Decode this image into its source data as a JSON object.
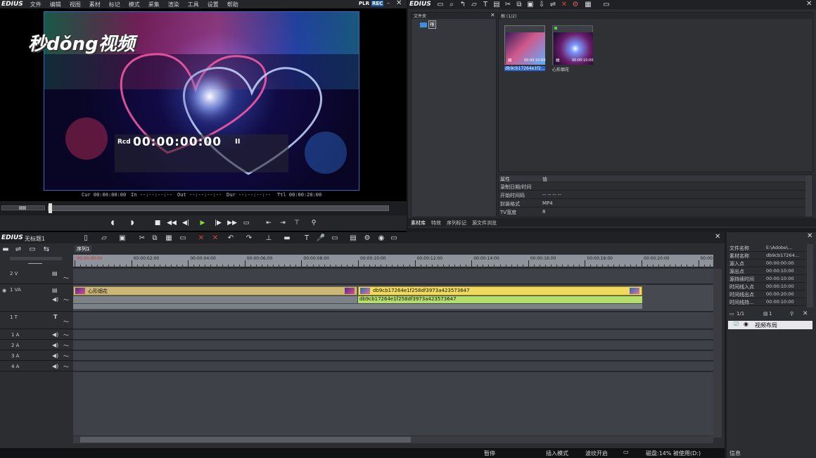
{
  "player": {
    "brand": "EDIUS",
    "menu": [
      "文件",
      "编辑",
      "视图",
      "素材",
      "标记",
      "模式",
      "采集",
      "渲染",
      "工具",
      "设置",
      "帮助"
    ],
    "plr": "PLR",
    "rec": "REC",
    "watermark": "秒dǒng视频",
    "rcd_label": "Rcd",
    "rcd_time": "00:00:00:00",
    "rcd_pause": "II",
    "cur_label": "Cur",
    "cur_time": "00:00:00:00",
    "in_label": "In",
    "in_time": "--:--:--:--",
    "out_label": "Out",
    "out_time": "--:--:--:--",
    "dur_label": "Dur",
    "dur_time": "--:--:--:--",
    "ttl_label": "Ttl",
    "ttl_time": "00:00:20:00"
  },
  "bin": {
    "brand": "EDIUS",
    "folder_panel_title": "文件夹",
    "folder_root": "根",
    "path": "根 (1/2)",
    "clips": [
      {
        "name": "db9cb17264e1f2...",
        "time": "00:00:10:00",
        "selected": true
      },
      {
        "name": "心形烟花",
        "time": "00:00:10:00",
        "selected": false
      }
    ],
    "props_header": [
      "属性",
      "值"
    ],
    "props": [
      {
        "k": "录制日期/时间",
        "v": ""
      },
      {
        "k": "开始时间码",
        "v": "-- -- -- --"
      },
      {
        "k": "封装格式",
        "v": "MP4"
      },
      {
        "k": "TV宽度",
        "v": "8"
      }
    ],
    "tabs": [
      "素材库",
      "特效",
      "序列标记",
      "源文件浏览"
    ]
  },
  "timeline": {
    "brand": "EDIUS",
    "project": "无标题1",
    "sequence_tab": "序列1",
    "ruler": [
      "00:00:00:00",
      "00:00:02:00",
      "00:00:04:00",
      "00:00:06:00",
      "00:00:08:00",
      "00:00:10:00",
      "00:00:12:00",
      "00:00:14:00",
      "00:00:16:00",
      "00:00:18:00",
      "00:00:20:00",
      "00:00"
    ],
    "tracks": {
      "v2": "2 V",
      "va1": "1 VA",
      "t1": "1 T",
      "a1": "1 A",
      "a2": "2 A",
      "a3": "3 A",
      "a4": "4 A"
    },
    "clip1_name": "心形烟花",
    "clip2_name": "db9cb17264e1f258df3973a423573647",
    "clip2_audio": "db9cb17264e1f258df3973a423573647"
  },
  "info": {
    "rows": [
      {
        "k": "文件名称",
        "v": "E:\\Adobe\\..."
      },
      {
        "k": "素材名称",
        "v": "db9cb17264..."
      },
      {
        "k": "源入点",
        "v": "00:00:00:00"
      },
      {
        "k": "源出点",
        "v": "00:00:10:00"
      },
      {
        "k": "源持续时间",
        "v": "00:00:10:00"
      },
      {
        "k": "时间线入点",
        "v": "00:00:10:00"
      },
      {
        "k": "时间线出点",
        "v": "00:00:20:00"
      },
      {
        "k": "时间线持...",
        "v": "00:00:10:00"
      }
    ],
    "layer_count": "1/1",
    "layer_count2": "1",
    "layout_item": "视频布局",
    "tab": "信息"
  },
  "status": {
    "pause": "暂停",
    "insert_mode": "插入模式",
    "ripple": "波纹开启",
    "disk": "磁盘:14%  被使用(D:)"
  }
}
